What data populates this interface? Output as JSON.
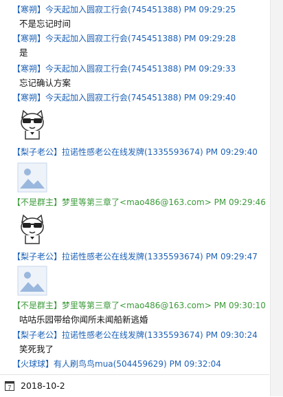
{
  "messages": [
    {
      "sender": "【寒朔】",
      "group": "今天起加入圆寂工行会(745451388)",
      "time": "PM 09:29:25",
      "color": "blue",
      "text": "不是忘记时间"
    },
    {
      "sender": "【寒朔】",
      "group": "今天起加入圆寂工行会(745451388)",
      "time": "PM 09:29:28",
      "color": "blue",
      "text": "是"
    },
    {
      "sender": "【寒朔】",
      "group": "今天起加入圆寂工行会(745451388)",
      "time": "PM 09:29:33",
      "color": "blue",
      "text": "忘记确认方案"
    },
    {
      "sender": "【寒朔】",
      "group": "今天起加入圆寂工行会(745451388)",
      "time": "PM 09:29:40",
      "color": "blue",
      "image": "cat-sticker"
    },
    {
      "sender": "【梨子老公】",
      "group": "拉诺性感老公在线发牌(1335593674)",
      "time": "PM 09:29:40",
      "color": "blue",
      "image": "image-placeholder"
    },
    {
      "sender": "【不是群主】",
      "group": "梦里等第三章了<mao486@163.com>",
      "time": "PM 09:29:46",
      "color": "green",
      "image": "cat-sticker"
    },
    {
      "sender": "【梨子老公】",
      "group": "拉诺性感老公在线发牌(1335593674)",
      "time": "PM 09:29:47",
      "color": "blue",
      "image": "image-placeholder"
    },
    {
      "sender": "【不是群主】",
      "group": "梦里等第三章了<mao486@163.com>",
      "time": "PM 09:30:10",
      "color": "green",
      "text": "咕咕乐园带给你闻所未闻船新逃婚"
    },
    {
      "sender": "【梨子老公】",
      "group": "拉诺性感老公在线发牌(1335593674)",
      "time": "PM 09:30:24",
      "color": "blue",
      "text": "笑死我了"
    },
    {
      "sender": "【火球球】",
      "group": "有人刷鸟鸟mua(504459629)",
      "time": "PM 09:32:04",
      "color": "blue"
    }
  ],
  "footer": {
    "date": "2018-10-2",
    "icon": "calendar-icon",
    "icon_digit": "7"
  },
  "colors": {
    "blue": "#1c61b7",
    "green": "#3b9a39"
  }
}
